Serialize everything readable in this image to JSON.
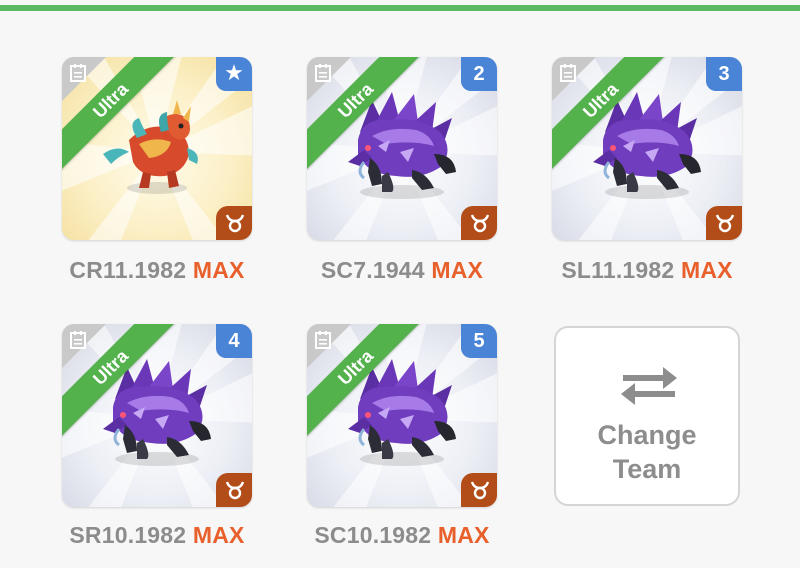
{
  "colors": {
    "accent_green": "#5db865",
    "ribbon_green": "#53b24c",
    "badge_blue": "#4a84d6",
    "sign_orange": "#b24d1a",
    "max_orange": "#e8602c",
    "code_gray": "#8c8c8c"
  },
  "team": [
    {
      "slot_badge": "★",
      "badge_icon": "star-icon",
      "rarity": "Ultra",
      "code": "CR11.1982",
      "level": "MAX",
      "monster": "red-gold-dragon",
      "background": "gold"
    },
    {
      "slot_badge": "2",
      "rarity": "Ultra",
      "code": "SC7.1944",
      "level": "MAX",
      "monster": "purple-crystal-beast",
      "background": "silver"
    },
    {
      "slot_badge": "3",
      "rarity": "Ultra",
      "code": "SL11.1982",
      "level": "MAX",
      "monster": "purple-crystal-beast",
      "background": "silver"
    },
    {
      "slot_badge": "4",
      "rarity": "Ultra",
      "code": "SR10.1982",
      "level": "MAX",
      "monster": "purple-crystal-beast",
      "background": "silver"
    },
    {
      "slot_badge": "5",
      "rarity": "Ultra",
      "code": "SC10.1982",
      "level": "MAX",
      "monster": "purple-crystal-beast",
      "background": "silver"
    }
  ],
  "element_icon": "taurus-icon",
  "actions": {
    "change_team_label": "Change\nTeam",
    "change_team_icon": "swap-arrows-icon"
  }
}
